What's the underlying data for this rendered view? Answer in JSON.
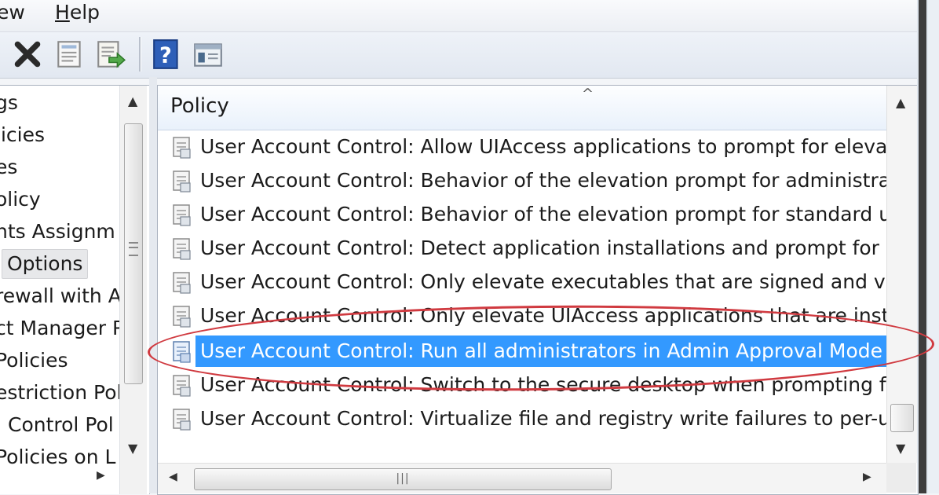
{
  "menu": {
    "items": [
      {
        "before": "",
        "mnemonic": "",
        "after": "ew"
      },
      {
        "before": "",
        "mnemonic": "H",
        "after": "elp"
      }
    ]
  },
  "toolbar": {
    "buttons": [
      "delete-icon",
      "properties-icon",
      "export-list-icon",
      "help-icon",
      "show-hide-pane-icon"
    ]
  },
  "tree": {
    "items": [
      {
        "label": "gs",
        "selected": false
      },
      {
        "label": "licies",
        "selected": false
      },
      {
        "label": "es",
        "selected": false
      },
      {
        "label": "olicy",
        "selected": false
      },
      {
        "label": "hts Assignm",
        "selected": false
      },
      {
        "label": "Options",
        "selected": true
      },
      {
        "label": "rewall with A",
        "selected": false
      },
      {
        "label": "ct Manager P",
        "selected": false
      },
      {
        "label": "Policies",
        "selected": false
      },
      {
        "label": "estriction Pol",
        "selected": false
      },
      {
        "label": "Control Pol",
        "selected": false
      },
      {
        "label": "Policies on L",
        "selected": false
      }
    ]
  },
  "list": {
    "column_header": "Policy",
    "rows": [
      {
        "text": "User Account Control: Allow UIAccess applications to prompt for elevatio",
        "selected": false
      },
      {
        "text": "User Account Control: Behavior of the elevation prompt for administrato",
        "selected": false
      },
      {
        "text": "User Account Control: Behavior of the elevation prompt for standard use",
        "selected": false
      },
      {
        "text": "User Account Control: Detect application installations and prompt for ele",
        "selected": false
      },
      {
        "text": "User Account Control: Only elevate executables that are signed and valid",
        "selected": false
      },
      {
        "text": "User Account Control: Only elevate UIAccess applications that are installe",
        "selected": false
      },
      {
        "text": "User Account Control: Run all administrators in Admin Approval Mode",
        "selected": true
      },
      {
        "text": "User Account Control: Switch to the secure desktop when prompting for",
        "selected": false
      },
      {
        "text": "User Account Control: Virtualize file and registry write failures to per-user",
        "selected": false
      }
    ]
  },
  "colors": {
    "selection": "#3399ff",
    "annotation_ellipse": "#d03a40"
  }
}
